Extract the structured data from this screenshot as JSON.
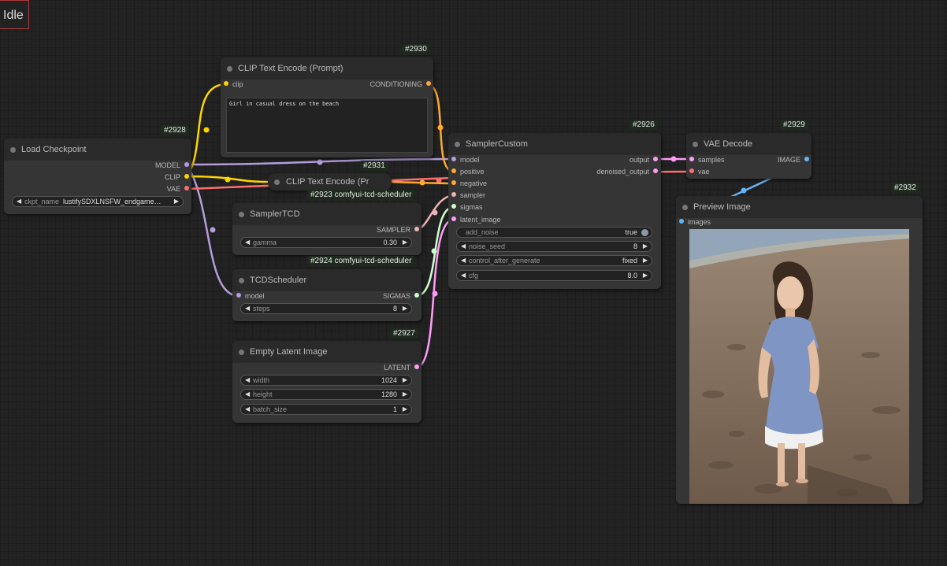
{
  "status": {
    "label": "Idle",
    "color": "#b03a3a"
  },
  "nodes": {
    "load_checkpoint": {
      "id": "#2928",
      "title": "Load Checkpoint",
      "outputs": [
        "MODEL",
        "CLIP",
        "VAE"
      ],
      "widgets": {
        "ckpt_name": {
          "label": "ckpt_name",
          "value": "lustifySDXLNSFW_endgame…"
        }
      }
    },
    "clip_text_encode_prompt": {
      "id": "#2930",
      "title": "CLIP Text Encode (Prompt)",
      "inputs": [
        "clip"
      ],
      "outputs": [
        "CONDITIONING"
      ],
      "text": "Girl in casual dress on the beach"
    },
    "clip_text_encode_collapsed": {
      "id": "#2931",
      "title": "CLIP Text Encode (Pr"
    },
    "sampler_tcd": {
      "id": "#2923 comfyui-tcd-scheduler",
      "title": "SamplerTCD",
      "outputs": [
        "SAMPLER"
      ],
      "widgets": {
        "gamma": {
          "label": "gamma",
          "value": "0.30"
        }
      }
    },
    "tcd_scheduler": {
      "id": "#2924 comfyui-tcd-scheduler",
      "title": "TCDScheduler",
      "inputs": [
        "model"
      ],
      "outputs": [
        "SIGMAS"
      ],
      "widgets": {
        "steps": {
          "label": "steps",
          "value": "8"
        }
      }
    },
    "empty_latent": {
      "id": "#2927",
      "title": "Empty Latent Image",
      "outputs": [
        "LATENT"
      ],
      "widgets": {
        "width": {
          "label": "width",
          "value": "1024"
        },
        "height": {
          "label": "height",
          "value": "1280"
        },
        "batch_size": {
          "label": "batch_size",
          "value": "1"
        }
      }
    },
    "sampler_custom": {
      "id": "#2926",
      "title": "SamplerCustom",
      "inputs": [
        "model",
        "positive",
        "negative",
        "sampler",
        "sigmas",
        "latent_image"
      ],
      "outputs": [
        "output",
        "denoised_output"
      ],
      "widgets": {
        "add_noise": {
          "label": "add_noise",
          "value": "true"
        },
        "noise_seed": {
          "label": "noise_seed",
          "value": "8"
        },
        "control_after_generate": {
          "label": "control_after_generate",
          "value": "fixed"
        },
        "cfg": {
          "label": "cfg",
          "value": "8.0"
        }
      }
    },
    "vae_decode": {
      "id": "#2929",
      "title": "VAE Decode",
      "inputs": [
        "samples",
        "vae"
      ],
      "outputs": [
        "IMAGE"
      ]
    },
    "preview_image": {
      "id": "#2932",
      "title": "Preview Image",
      "inputs": [
        "images"
      ]
    }
  },
  "colors": {
    "model": "#b39ddb",
    "clip": "#ffd500",
    "vae": "#ff6e6e",
    "conditioning": "#ffa931",
    "sampler": "#ecb4b4",
    "sigmas": "#cdffcd",
    "latent": "#ff9cf9",
    "image": "#64b5f6"
  }
}
